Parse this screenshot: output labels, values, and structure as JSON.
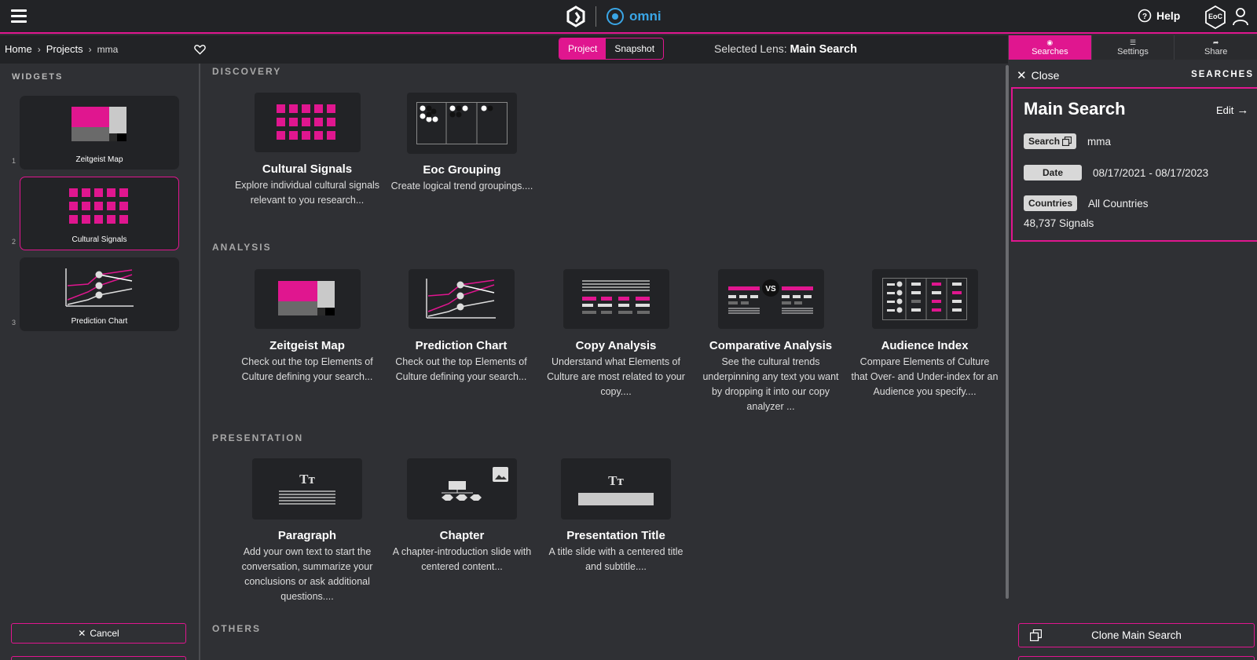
{
  "header": {
    "brand_name": "omni",
    "help_label": "Help",
    "badge_text": "EoC"
  },
  "breadcrumb": {
    "home": "Home",
    "projects": "Projects",
    "current": "mma"
  },
  "mode_toggle": {
    "project": "Project",
    "snapshot": "Snapshot",
    "selected": "Project"
  },
  "lens": {
    "prefix": "Selected Lens:",
    "name": "Main Search"
  },
  "right_tabs": [
    {
      "label": "Searches",
      "icon": "eye-icon",
      "active": true
    },
    {
      "label": "Settings",
      "icon": "sliders-icon",
      "active": false
    },
    {
      "label": "Share",
      "icon": "share-icon",
      "active": false
    }
  ],
  "sidebar": {
    "title": "WIDGETS",
    "widgets": [
      {
        "index": "1",
        "label": "Zeitgeist Map",
        "selected": false
      },
      {
        "index": "2",
        "label": "Cultural Signals",
        "selected": true
      },
      {
        "index": "3",
        "label": "Prediction Chart",
        "selected": false
      }
    ],
    "cancel_label": "Cancel"
  },
  "sections": {
    "discovery": "DISCOVERY",
    "analysis": "ANALYSIS",
    "presentation": "PRESENTATION",
    "others": "OTHERS"
  },
  "cards": {
    "cultural_signals": {
      "title": "Cultural Signals",
      "desc": "Explore individual cultural signals relevant to you research..."
    },
    "eoc_grouping": {
      "title": "Eoc Grouping",
      "desc": "Create logical trend groupings...."
    },
    "zeitgeist_map": {
      "title": "Zeitgeist Map",
      "desc": "Check out the top Elements of Culture defining your search..."
    },
    "prediction_chart": {
      "title": "Prediction Chart",
      "desc": "Check out the top Elements of Culture defining your search..."
    },
    "copy_analysis": {
      "title": "Copy Analysis",
      "desc": "Understand what Elements of Culture are most related to your copy...."
    },
    "comparative_analysis": {
      "title": "Comparative Analysis",
      "desc": "See the cultural trends underpinning any text you want by dropping it into our copy analyzer ..."
    },
    "audience_index": {
      "title": "Audience Index",
      "desc": "Compare Elements of Culture that Over- and Under-index for an Audience you specify...."
    },
    "paragraph": {
      "title": "Paragraph",
      "desc": "Add your own text to start the conversation, summarize your conclusions or ask additional questions...."
    },
    "chapter": {
      "title": "Chapter",
      "desc": "A chapter-introduction slide with centered content..."
    },
    "presentation_title": {
      "title": "Presentation Title",
      "desc": "A title slide with a centered title and subtitle...."
    }
  },
  "right_panel": {
    "close_label": "Close",
    "title": "SEARCHES",
    "search_name": "Main Search",
    "edit_label": "Edit",
    "search_label": "Search",
    "search_value": "mma",
    "date_label": "Date",
    "date_value": "08/17/2021 - 08/17/2023",
    "countries_label": "Countries",
    "countries_value": "All Countries",
    "signals_count": "48,737 Signals",
    "clone_label": "Clone Main Search"
  },
  "colors": {
    "accent": "#e0168f",
    "background": "#2f3034",
    "panel": "#222326",
    "omni_blue": "#3aa6e6"
  }
}
